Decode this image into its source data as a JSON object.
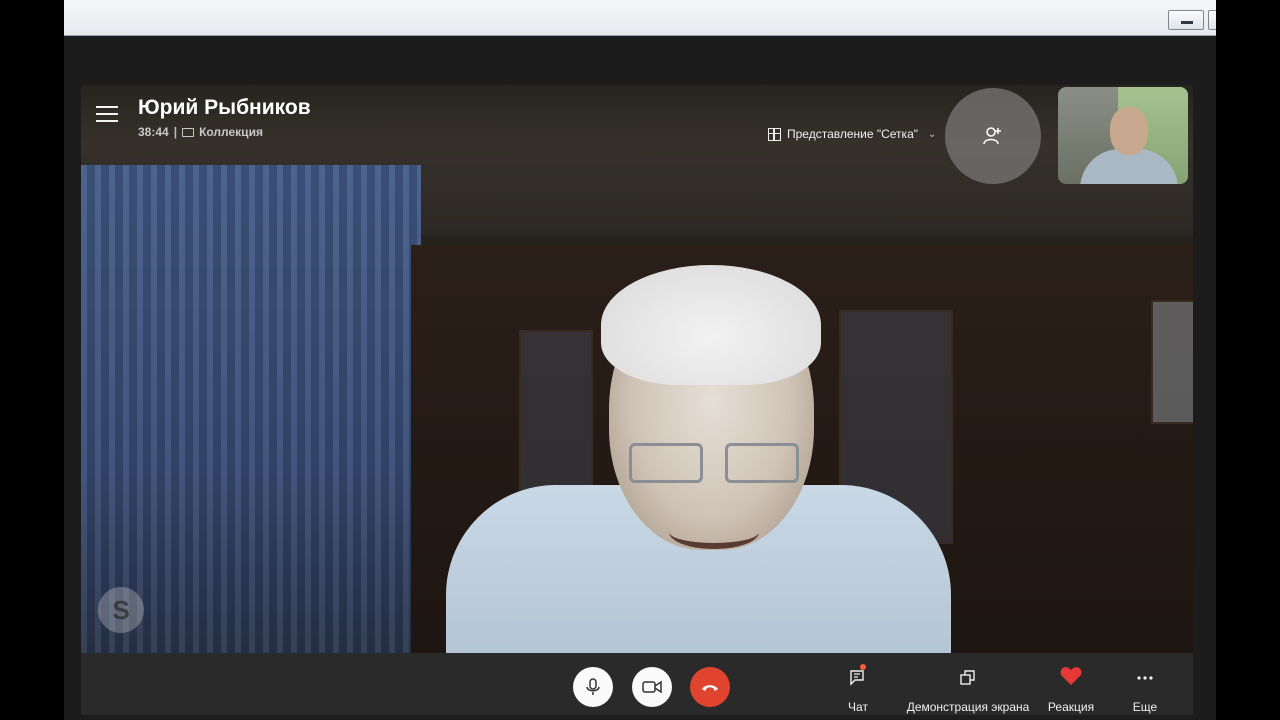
{
  "call": {
    "contact_name": "Юрий Рыбников",
    "duration": "38:44",
    "separator": "|",
    "gallery_label": "Коллекция"
  },
  "view": {
    "label": "Представление \"Сетка\""
  },
  "controls": {
    "mic_icon": "microphone-icon",
    "video_icon": "video-camera-icon",
    "hangup_icon": "phone-hangup-icon",
    "hangup_color": "#e0442f"
  },
  "actions": {
    "chat": "Чат",
    "share": "Демонстрация экрана",
    "react": "Реакция",
    "more": "Еще"
  },
  "watermark": "S",
  "colors": {
    "accent_red": "#e0442f",
    "heart": "#e53935"
  }
}
